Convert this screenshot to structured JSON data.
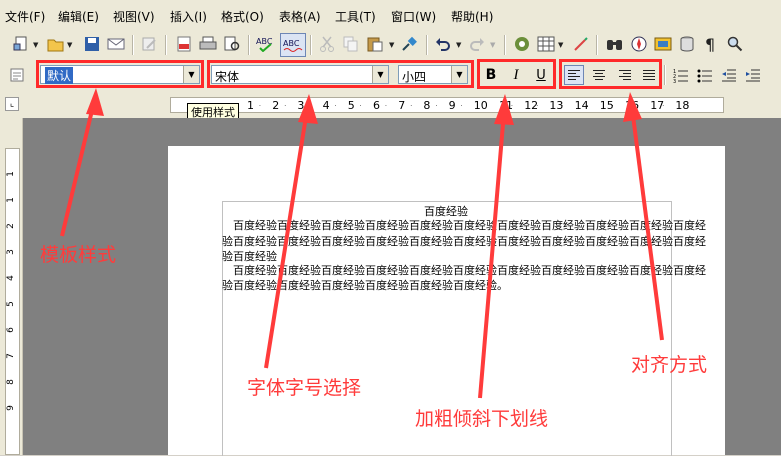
{
  "menu": [
    "文件(F)",
    "编辑(E)",
    "视图(V)",
    "插入(I)",
    "格式(O)",
    "表格(A)",
    "工具(T)",
    "窗口(W)",
    "帮助(H)"
  ],
  "formatting": {
    "style_value": "默认",
    "font_value": "宋体",
    "size_value": "小四",
    "bold_label": "B",
    "italic_label": "I",
    "underline_label": "U"
  },
  "tooltip": "使用样式",
  "ruler": {
    "h_ticks": [
      "1",
      "2",
      "3",
      "4",
      "5",
      "6",
      "7",
      "8",
      "9",
      "10",
      "11",
      "12",
      "13",
      "14",
      "15",
      "16",
      "17",
      "18"
    ],
    "v_ticks": [
      "1",
      "1",
      "2",
      "3",
      "4",
      "5",
      "6",
      "7",
      "8",
      "9"
    ]
  },
  "document": {
    "title": "百度经验",
    "lines": [
      "　百度经验百度经验百度经验百度经验百度经验百度经验百度经验百度经验百度经验百度经验百度经",
      "验百度经验百度经验百度经验百度经验百度经验百度经验百度经验百度经验百度经验百度经验百度经",
      "验百度经验",
      "　百度经验百度经验百度经验百度经验百度经验百度经验百度经验百度经验百度经验百度经验百度经",
      "验百度经验百度经验百度经验百度经验百度经验百度经验。"
    ]
  },
  "annotations": {
    "template": "模板样式",
    "font": "字体字号选择",
    "bold": "加粗倾斜下划线",
    "align": "对齐方式"
  },
  "colors": {
    "annotation": "#ff3b3b",
    "selection": "#316ac5"
  }
}
